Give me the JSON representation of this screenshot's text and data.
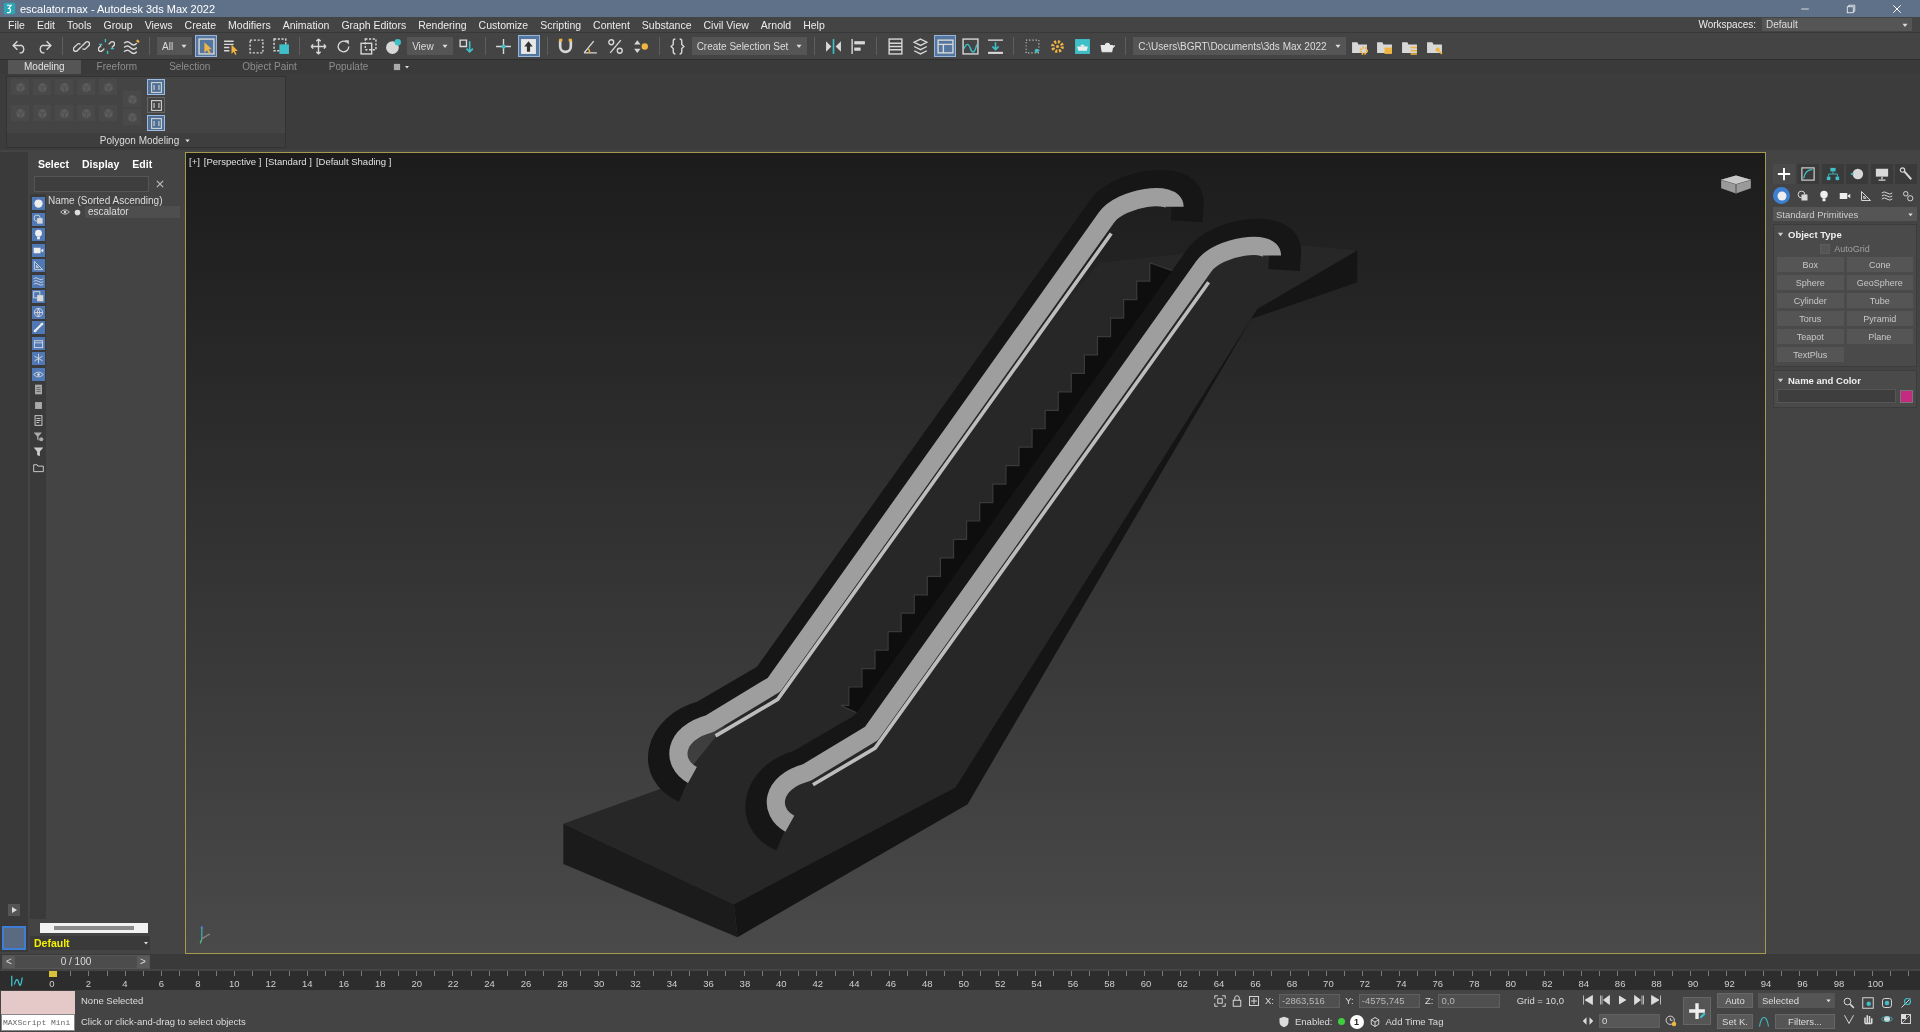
{
  "window": {
    "title": "escalator.max - Autodesk 3ds Max 2022"
  },
  "menu": [
    "File",
    "Edit",
    "Tools",
    "Group",
    "Views",
    "Create",
    "Modifiers",
    "Animation",
    "Graph Editors",
    "Rendering",
    "Customize",
    "Scripting",
    "Content",
    "Substance",
    "Civil View",
    "Arnold",
    "Help"
  ],
  "workspace": {
    "label": "Workspaces:",
    "value": "Default"
  },
  "toolbar": [
    {
      "kind": "undo",
      "selected": false
    },
    {
      "kind": "redo",
      "selected": false
    },
    {
      "kind": "separator"
    },
    {
      "kind": "link",
      "selected": false
    },
    {
      "kind": "unlink",
      "selected": false
    },
    {
      "kind": "bind",
      "selected": false
    },
    {
      "kind": "separator"
    },
    {
      "kind": "dropdown",
      "value": "All"
    },
    {
      "kind": "select",
      "selected": true
    },
    {
      "kind": "select-by-name",
      "selected": false
    },
    {
      "kind": "rect-region",
      "selected": false
    },
    {
      "kind": "window-crossing",
      "selected": false
    },
    {
      "kind": "separator"
    },
    {
      "kind": "move",
      "selected": false
    },
    {
      "kind": "rotate",
      "selected": false
    },
    {
      "kind": "scale",
      "selected": false
    },
    {
      "kind": "place",
      "selected": false
    },
    {
      "kind": "dropdown",
      "value": "View"
    },
    {
      "kind": "pivot",
      "selected": false
    },
    {
      "kind": "separator"
    },
    {
      "kind": "manipulate",
      "selected": false
    },
    {
      "kind": "keyboard",
      "selected": true
    },
    {
      "kind": "separator"
    },
    {
      "kind": "snap",
      "selected": false
    },
    {
      "kind": "angle-snap",
      "selected": false
    },
    {
      "kind": "percent-snap",
      "selected": false
    },
    {
      "kind": "spinner-snap",
      "selected": false
    },
    {
      "kind": "separator"
    },
    {
      "kind": "named-sets",
      "selected": false
    },
    {
      "kind": "dropdown",
      "value": "Create Selection Set"
    },
    {
      "kind": "separator"
    },
    {
      "kind": "mirror",
      "selected": false
    },
    {
      "kind": "align",
      "selected": false
    },
    {
      "kind": "separator"
    },
    {
      "kind": "scene-explorer",
      "selected": false
    },
    {
      "kind": "layer-explorer",
      "selected": false
    },
    {
      "kind": "ribbon",
      "selected": true
    },
    {
      "kind": "curve-editor",
      "selected": false
    },
    {
      "kind": "schematic",
      "selected": false
    },
    {
      "kind": "separator"
    },
    {
      "kind": "material",
      "selected": false
    },
    {
      "kind": "render-setup",
      "selected": false
    },
    {
      "kind": "rendered-frame",
      "selected": false
    },
    {
      "kind": "render",
      "selected": false
    },
    {
      "kind": "separator"
    },
    {
      "kind": "dropdown",
      "value": "C:\\Users\\BGRT\\Documents\\3ds Max 2022"
    },
    {
      "kind": "project-settings",
      "selected": false
    },
    {
      "kind": "project-folder",
      "selected": false
    },
    {
      "kind": "project-tree",
      "selected": false
    },
    {
      "kind": "project-key",
      "selected": false
    }
  ],
  "ribbon": {
    "tabs": [
      {
        "label": "Modeling",
        "selected": true
      },
      {
        "label": "Freeform",
        "selected": false
      },
      {
        "label": "Selection",
        "selected": false
      },
      {
        "label": "Object Paint",
        "selected": false
      },
      {
        "label": "Populate",
        "selected": false
      }
    ],
    "tools": [
      {
        "disabled": true
      },
      {
        "disabled": true
      },
      {
        "disabled": true
      },
      {
        "disabled": true
      },
      {
        "disabled": true
      },
      {
        "disabled": true
      },
      {
        "disabled": true
      },
      {
        "disabled": true
      },
      {
        "disabled": true
      },
      {
        "disabled": true
      },
      {
        "disabled": true
      },
      {
        "disabled": true
      }
    ],
    "side_tools": [
      {
        "selected": true
      },
      {
        "selected": false
      },
      {
        "selected": true
      }
    ],
    "panel_title": "Polygon Modeling"
  },
  "scene_explorer": {
    "menu": [
      "Select",
      "Display",
      "Edit"
    ],
    "filters": [
      {
        "kind": "geometry",
        "selected": true
      },
      {
        "kind": "shapes",
        "selected": true
      },
      {
        "kind": "lights",
        "selected": true
      },
      {
        "kind": "cameras",
        "selected": true
      },
      {
        "kind": "helpers",
        "selected": true
      },
      {
        "kind": "spacewarps",
        "selected": true
      },
      {
        "kind": "groups",
        "selected": true
      },
      {
        "kind": "xrefs",
        "selected": true
      },
      {
        "kind": "bones",
        "selected": true
      },
      {
        "kind": "containers",
        "selected": true
      },
      {
        "kind": "frozen",
        "selected": true
      },
      {
        "kind": "hidden",
        "selected": true
      },
      {
        "kind": "list",
        "selected": false
      },
      {
        "kind": "square",
        "selected": false
      },
      {
        "kind": "page",
        "selected": false
      },
      {
        "kind": "filter",
        "selected": false
      },
      {
        "kind": "funnel",
        "selected": false
      },
      {
        "kind": "folder",
        "selected": false
      }
    ],
    "column": "Name (Sorted Ascending)",
    "items": [
      {
        "name": "escalator",
        "visible": true
      }
    ],
    "layer": "Default"
  },
  "viewport": {
    "labels": [
      "[+]",
      "[Perspective ]",
      "[Standard ]",
      "[Default Shading ]"
    ],
    "active": true
  },
  "command_panel": {
    "tabs": [
      {
        "kind": "create",
        "selected": true
      },
      {
        "kind": "modify",
        "selected": false
      },
      {
        "kind": "hierarchy",
        "selected": false
      },
      {
        "kind": "motion",
        "selected": false
      },
      {
        "kind": "display",
        "selected": false
      },
      {
        "kind": "utilities",
        "selected": false
      }
    ],
    "categories": [
      {
        "kind": "geometry",
        "selected": true
      },
      {
        "kind": "shapes",
        "selected": false
      },
      {
        "kind": "lights",
        "selected": false
      },
      {
        "kind": "cameras",
        "selected": false
      },
      {
        "kind": "helpers",
        "selected": false
      },
      {
        "kind": "spacewarps",
        "selected": false
      },
      {
        "kind": "systems",
        "selected": false
      }
    ],
    "type": "Standard Primitives",
    "object_type": {
      "title": "Object Type",
      "expanded": true,
      "autogrid": {
        "label": "AutoGrid",
        "checked": false,
        "disabled": true
      },
      "buttons": [
        "Box",
        "Cone",
        "Sphere",
        "GeoSphere",
        "Cylinder",
        "Tube",
        "Torus",
        "Pyramid",
        "Teapot",
        "Plane",
        "TextPlus"
      ]
    },
    "name_and_color": {
      "title": "Name and Color",
      "expanded": true,
      "color": "#c42a80"
    }
  },
  "time_slider": {
    "label": "0 / 100",
    "level": 0,
    "prev": "<",
    "next": ">"
  },
  "trackbar": {
    "ticks": [
      "0",
      "2",
      "4",
      "6",
      "8",
      "10",
      "12",
      "14",
      "16",
      "18",
      "20",
      "22",
      "24",
      "26",
      "28",
      "30",
      "32",
      "34",
      "36",
      "38",
      "40",
      "42",
      "44",
      "46",
      "48",
      "50",
      "52",
      "54",
      "56",
      "58",
      "60",
      "62",
      "64",
      "66",
      "68",
      "70",
      "72",
      "74",
      "76",
      "78",
      "80",
      "82",
      "84",
      "86",
      "88",
      "90",
      "92",
      "94",
      "96",
      "98",
      "100"
    ]
  },
  "status": {
    "listener": {
      "placeholder": "MAXScript Mini"
    },
    "selection": "None Selected",
    "prompt": "Click or click-and-drag to select objects",
    "coords": [
      {
        "label": "X:",
        "value": "-2863,516"
      },
      {
        "label": "Y:",
        "value": "-4575,745"
      },
      {
        "label": "Z:",
        "value": "0,0"
      }
    ],
    "coords_disabled": true,
    "grid": "Grid = 10,0",
    "time_tags": {
      "label": "Enabled:",
      "on": true,
      "count": "1",
      "add": "Add Time Tag"
    },
    "frame": "0",
    "auto_key": "Auto",
    "set_key": "Set K.",
    "key_filter": "Selected",
    "filters": "Filters..."
  }
}
